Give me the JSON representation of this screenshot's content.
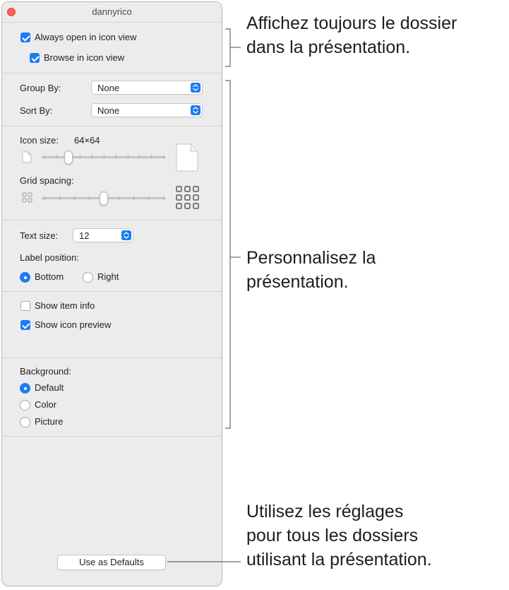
{
  "window": {
    "title": "dannyrico"
  },
  "view_options": {
    "always_open_icon_view": {
      "label": "Always open in icon view",
      "checked": true
    },
    "browse_icon_view": {
      "label": "Browse in icon view",
      "checked": true
    }
  },
  "arrange": {
    "group_by": {
      "label": "Group By:",
      "value": "None"
    },
    "sort_by": {
      "label": "Sort By:",
      "value": "None"
    }
  },
  "icon_size": {
    "label": "Icon size:",
    "value": "64×64",
    "slider_fraction": 0.2
  },
  "grid_spacing": {
    "label": "Grid spacing:",
    "slider_fraction": 0.5
  },
  "text": {
    "size_label": "Text size:",
    "size_value": "12",
    "label_position_label": "Label position:",
    "bottom_label": "Bottom",
    "right_label": "Right",
    "selected_position": "Bottom"
  },
  "show": {
    "item_info": {
      "label": "Show item info",
      "checked": false
    },
    "icon_preview": {
      "label": "Show icon preview",
      "checked": true
    }
  },
  "background": {
    "label": "Background:",
    "options": [
      "Default",
      "Color",
      "Picture"
    ],
    "selected": "Default"
  },
  "defaults_button": {
    "label": "Use as Defaults"
  },
  "callouts": {
    "top": [
      "Affichez toujours le dossier",
      "dans la présentation."
    ],
    "middle": [
      "Personnalisez la",
      "présentation."
    ],
    "bottom": [
      "Utilisez les réglages",
      "pour tous les dossiers",
      "utilisant la présentation."
    ]
  },
  "colors": {
    "accent": "#1a7cf5",
    "close_button": "#fe5f57",
    "panel_background": "#ececec"
  }
}
